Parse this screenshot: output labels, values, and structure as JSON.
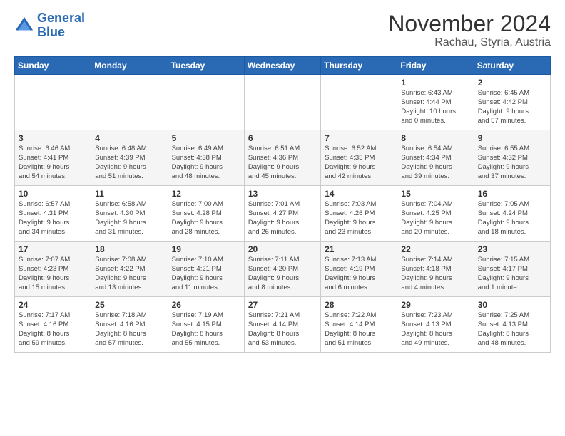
{
  "header": {
    "logo_line1": "General",
    "logo_line2": "Blue",
    "title": "November 2024",
    "subtitle": "Rachau, Styria, Austria"
  },
  "weekdays": [
    "Sunday",
    "Monday",
    "Tuesday",
    "Wednesday",
    "Thursday",
    "Friday",
    "Saturday"
  ],
  "weeks": [
    [
      {
        "day": "",
        "detail": ""
      },
      {
        "day": "",
        "detail": ""
      },
      {
        "day": "",
        "detail": ""
      },
      {
        "day": "",
        "detail": ""
      },
      {
        "day": "",
        "detail": ""
      },
      {
        "day": "1",
        "detail": "Sunrise: 6:43 AM\nSunset: 4:44 PM\nDaylight: 10 hours\nand 0 minutes."
      },
      {
        "day": "2",
        "detail": "Sunrise: 6:45 AM\nSunset: 4:42 PM\nDaylight: 9 hours\nand 57 minutes."
      }
    ],
    [
      {
        "day": "3",
        "detail": "Sunrise: 6:46 AM\nSunset: 4:41 PM\nDaylight: 9 hours\nand 54 minutes."
      },
      {
        "day": "4",
        "detail": "Sunrise: 6:48 AM\nSunset: 4:39 PM\nDaylight: 9 hours\nand 51 minutes."
      },
      {
        "day": "5",
        "detail": "Sunrise: 6:49 AM\nSunset: 4:38 PM\nDaylight: 9 hours\nand 48 minutes."
      },
      {
        "day": "6",
        "detail": "Sunrise: 6:51 AM\nSunset: 4:36 PM\nDaylight: 9 hours\nand 45 minutes."
      },
      {
        "day": "7",
        "detail": "Sunrise: 6:52 AM\nSunset: 4:35 PM\nDaylight: 9 hours\nand 42 minutes."
      },
      {
        "day": "8",
        "detail": "Sunrise: 6:54 AM\nSunset: 4:34 PM\nDaylight: 9 hours\nand 39 minutes."
      },
      {
        "day": "9",
        "detail": "Sunrise: 6:55 AM\nSunset: 4:32 PM\nDaylight: 9 hours\nand 37 minutes."
      }
    ],
    [
      {
        "day": "10",
        "detail": "Sunrise: 6:57 AM\nSunset: 4:31 PM\nDaylight: 9 hours\nand 34 minutes."
      },
      {
        "day": "11",
        "detail": "Sunrise: 6:58 AM\nSunset: 4:30 PM\nDaylight: 9 hours\nand 31 minutes."
      },
      {
        "day": "12",
        "detail": "Sunrise: 7:00 AM\nSunset: 4:28 PM\nDaylight: 9 hours\nand 28 minutes."
      },
      {
        "day": "13",
        "detail": "Sunrise: 7:01 AM\nSunset: 4:27 PM\nDaylight: 9 hours\nand 26 minutes."
      },
      {
        "day": "14",
        "detail": "Sunrise: 7:03 AM\nSunset: 4:26 PM\nDaylight: 9 hours\nand 23 minutes."
      },
      {
        "day": "15",
        "detail": "Sunrise: 7:04 AM\nSunset: 4:25 PM\nDaylight: 9 hours\nand 20 minutes."
      },
      {
        "day": "16",
        "detail": "Sunrise: 7:05 AM\nSunset: 4:24 PM\nDaylight: 9 hours\nand 18 minutes."
      }
    ],
    [
      {
        "day": "17",
        "detail": "Sunrise: 7:07 AM\nSunset: 4:23 PM\nDaylight: 9 hours\nand 15 minutes."
      },
      {
        "day": "18",
        "detail": "Sunrise: 7:08 AM\nSunset: 4:22 PM\nDaylight: 9 hours\nand 13 minutes."
      },
      {
        "day": "19",
        "detail": "Sunrise: 7:10 AM\nSunset: 4:21 PM\nDaylight: 9 hours\nand 11 minutes."
      },
      {
        "day": "20",
        "detail": "Sunrise: 7:11 AM\nSunset: 4:20 PM\nDaylight: 9 hours\nand 8 minutes."
      },
      {
        "day": "21",
        "detail": "Sunrise: 7:13 AM\nSunset: 4:19 PM\nDaylight: 9 hours\nand 6 minutes."
      },
      {
        "day": "22",
        "detail": "Sunrise: 7:14 AM\nSunset: 4:18 PM\nDaylight: 9 hours\nand 4 minutes."
      },
      {
        "day": "23",
        "detail": "Sunrise: 7:15 AM\nSunset: 4:17 PM\nDaylight: 9 hours\nand 1 minute."
      }
    ],
    [
      {
        "day": "24",
        "detail": "Sunrise: 7:17 AM\nSunset: 4:16 PM\nDaylight: 8 hours\nand 59 minutes."
      },
      {
        "day": "25",
        "detail": "Sunrise: 7:18 AM\nSunset: 4:16 PM\nDaylight: 8 hours\nand 57 minutes."
      },
      {
        "day": "26",
        "detail": "Sunrise: 7:19 AM\nSunset: 4:15 PM\nDaylight: 8 hours\nand 55 minutes."
      },
      {
        "day": "27",
        "detail": "Sunrise: 7:21 AM\nSunset: 4:14 PM\nDaylight: 8 hours\nand 53 minutes."
      },
      {
        "day": "28",
        "detail": "Sunrise: 7:22 AM\nSunset: 4:14 PM\nDaylight: 8 hours\nand 51 minutes."
      },
      {
        "day": "29",
        "detail": "Sunrise: 7:23 AM\nSunset: 4:13 PM\nDaylight: 8 hours\nand 49 minutes."
      },
      {
        "day": "30",
        "detail": "Sunrise: 7:25 AM\nSunset: 4:13 PM\nDaylight: 8 hours\nand 48 minutes."
      }
    ]
  ]
}
